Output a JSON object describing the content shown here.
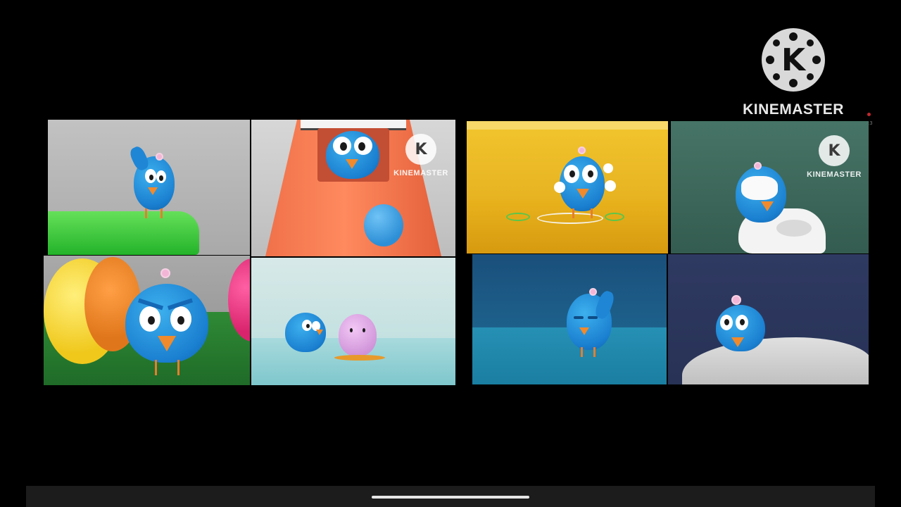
{
  "watermark": {
    "text": "KINEMASTER",
    "logo_letter": "K"
  },
  "recording_timer": "00:3",
  "panels": [
    {
      "name": "grey-scene",
      "bg": "#b8b8b8"
    },
    {
      "name": "orange-machine-scene",
      "bg": "#cfcfcf"
    },
    {
      "name": "yellow-scene",
      "bg": "#e7b31f"
    },
    {
      "name": "green-scene",
      "bg": "#3f6b5c"
    },
    {
      "name": "balls-scene",
      "bg": "#9a9a9a"
    },
    {
      "name": "egg-scene",
      "bg": "#bfe0e0"
    },
    {
      "name": "blue-scene",
      "bg": "#1d6c92"
    },
    {
      "name": "navy-scene",
      "bg": "#303a5e"
    }
  ]
}
